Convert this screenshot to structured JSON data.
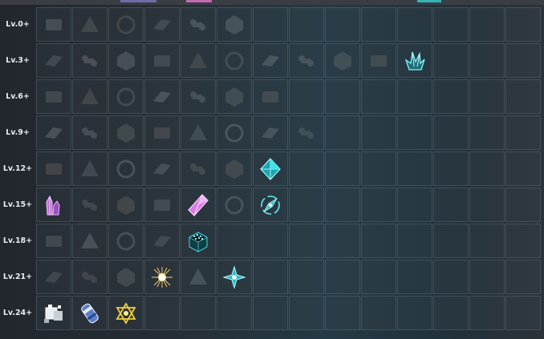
{
  "colors": {
    "grid_line": "#5f6e78",
    "level_text": "#e7ecef",
    "unlocked_cyan": "#3fe0e0",
    "unlocked_pink": "#e27ee6",
    "unlocked_gold": "#e8c53a"
  },
  "levels": [
    {
      "label": "Lv.0+"
    },
    {
      "label": "Lv.3+"
    },
    {
      "label": "Lv.6+"
    },
    {
      "label": "Lv.9+"
    },
    {
      "label": "Lv.12+"
    },
    {
      "label": "Lv.15+"
    },
    {
      "label": "Lv.18+"
    },
    {
      "label": "Lv.21+"
    },
    {
      "label": "Lv.24+"
    }
  ],
  "grid": [
    [
      "logs-icon",
      "vines-icon",
      "plate-icon",
      "wood-plank-icon",
      "wall-block-icon",
      "ring-icon",
      "",
      "",
      "",
      "",
      "",
      "",
      "",
      "",
      ""
    ],
    [
      "green-plate-icon",
      "metal-sheet-icon",
      "frame-icon",
      "pipes-icon",
      "green-block-icon",
      "triangle-icon",
      "gear-icon",
      "crown-ring-icon",
      "crab-icon",
      "rubble-icon",
      "cyan-crystal-cluster-icon",
      "",
      "",
      "",
      ""
    ],
    [
      "pyramid-icon",
      "cables-icon",
      "solar-panel-icon",
      "rod-icon",
      "girders-icon",
      "canisters-icon",
      "panels-icon",
      "",
      "",
      "",
      "",
      "",
      "",
      "",
      ""
    ],
    [
      "green-prism-icon",
      "wires-icon",
      "chip-icon",
      "nebula-icon",
      "orb-icon",
      "dots-icon",
      "hexagon-icon",
      "bolt-icon",
      "",
      "",
      "",
      "",
      "",
      "",
      ""
    ],
    [
      "beam-icon",
      "tile-icon",
      "battery-icon",
      "coil-icon",
      "tube-icon",
      "capsules-icon",
      "cyan-pyramid-icon",
      "",
      "",
      "",
      "",
      "",
      "",
      "",
      ""
    ],
    [
      "pink-crystals-icon",
      "spool-icon",
      "scroll-icon",
      "core-icon",
      "pink-gem-icon",
      "capsule-icon",
      "cyan-compass-icon",
      "",
      "",
      "",
      "",
      "",
      "",
      "",
      ""
    ],
    [
      "green-rings-icon",
      "layers-icon",
      "gears-icon",
      "ore-icon",
      "cyan-circuit-block-icon",
      "",
      "",
      "",
      "",
      "",
      "",
      "",
      "",
      "",
      ""
    ],
    [
      "grid-plate-icon",
      "disc-icon",
      "leaf-icon",
      "light-burst-icon",
      "vortex-icon",
      "cyan-star-icon",
      "",
      "",
      "",
      "",
      "",
      "",
      "",
      "",
      ""
    ],
    [
      "white-machine-icon",
      "blue-canister-icon",
      "gold-hexagram-icon",
      "",
      "",
      "",
      "",
      "",
      "",
      "",
      "",
      "",
      "",
      "",
      ""
    ]
  ],
  "unlocked": [
    "cyan-crystal-cluster-icon",
    "cyan-pyramid-icon",
    "pink-crystals-icon",
    "pink-gem-icon",
    "cyan-compass-icon",
    "cyan-circuit-block-icon",
    "light-burst-icon",
    "cyan-star-icon",
    "white-machine-icon",
    "blue-canister-icon",
    "gold-hexagram-icon"
  ]
}
